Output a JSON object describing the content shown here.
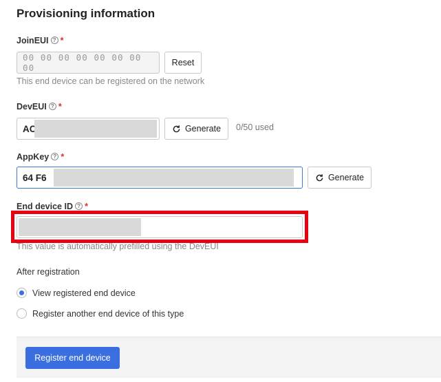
{
  "section_title": "Provisioning information",
  "join_eui": {
    "label": "JoinEUI",
    "value": "00 00 00 00 00 00 00 00",
    "reset_label": "Reset",
    "help_text": "This end device can be registered on the network"
  },
  "dev_eui": {
    "label": "DevEUI",
    "value_visible": "AC",
    "generate_label": "Generate",
    "counter": "0/50 used"
  },
  "app_key": {
    "label": "AppKey",
    "value_visible": "64  F6",
    "generate_label": "Generate"
  },
  "end_device_id": {
    "label": "End device ID",
    "help_text": "This value is automatically prefilled using the DevEUI"
  },
  "after_registration": {
    "label": "After registration",
    "options": [
      {
        "label": "View registered end device",
        "selected": true
      },
      {
        "label": "Register another end device of this type",
        "selected": false
      }
    ]
  },
  "submit_label": "Register end device",
  "colors": {
    "accent": "#3b6fe0",
    "required": "#d8352a",
    "highlight": "#e60012"
  }
}
